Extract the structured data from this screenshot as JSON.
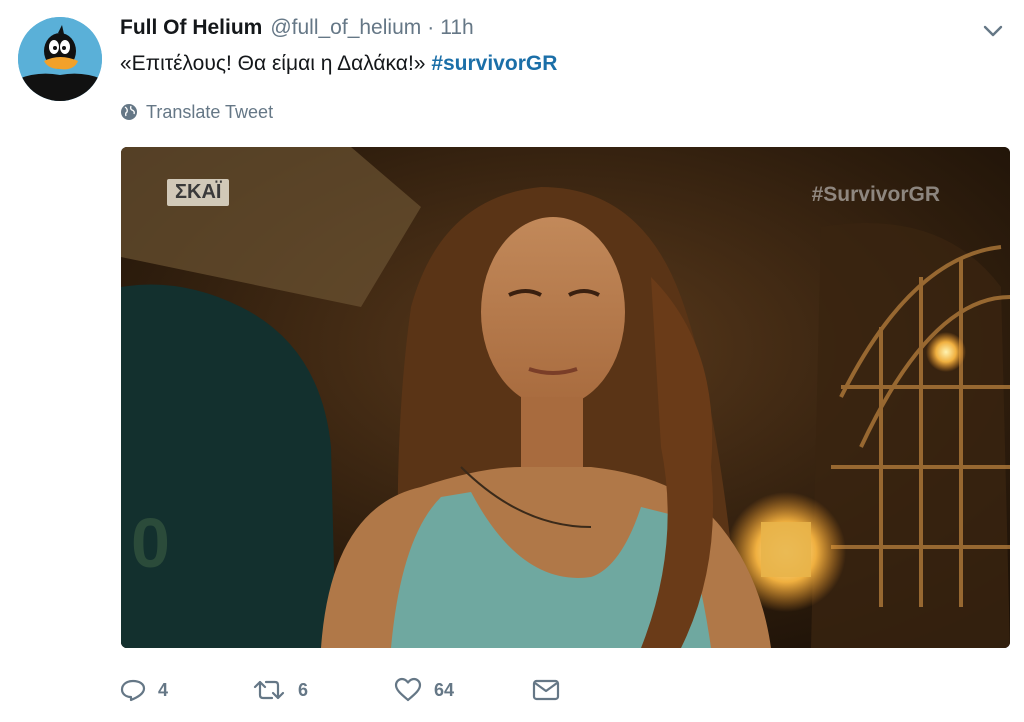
{
  "tweet": {
    "author": {
      "name": "Full Of Helium",
      "handle": "@full_of_helium",
      "avatar_icon": "daffy-duck-avatar"
    },
    "separator": "·",
    "time": "11h",
    "text": "«Επιτέλους! Θα είμαι η Δαλάκα!»",
    "hashtag": "#survivorGR",
    "translate_label": "Translate Tweet",
    "media": {
      "channel_logo": "ΣΚΑΪ",
      "watermark": "#SurvivorGR"
    },
    "actions": {
      "reply_count": "4",
      "retweet_count": "6",
      "like_count": "64"
    }
  },
  "colors": {
    "hashtag": "#1b6fa8",
    "secondary_text": "#657786",
    "primary_text": "#14171a"
  }
}
